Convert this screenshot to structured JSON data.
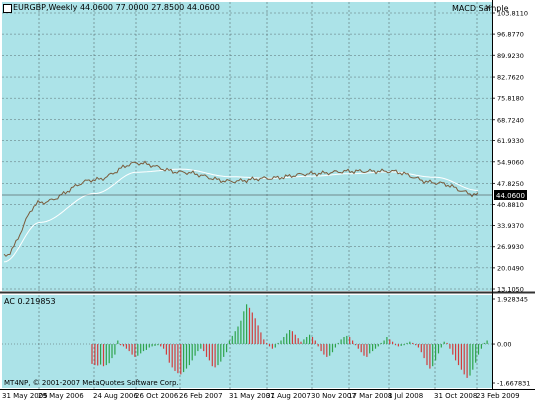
{
  "app": {
    "title": "MetaTrader chart window"
  },
  "colors": {
    "plot_bg": "#ace3e8",
    "grid": "#5a6e72",
    "price_line": "#7a5c3c",
    "signal_line": "#ffffff",
    "up_bar": "#2ea34a",
    "down_bar": "#d23c3c",
    "current_price_bg": "#000000",
    "axis_text": "#000000"
  },
  "header": {
    "symbol_info": "EURGBP,Weekly  44.0600 77.0000 27.8500 44.0600",
    "indicator": "MACD Sample",
    "close_glyph": "×"
  },
  "lower_panel": {
    "indicator_label": "AC 0.219853",
    "copyright": "MT4NP, © 2001-2007 MetaQuotes Software Corp."
  },
  "price_axis": {
    "ticks": [
      "103.8110",
      "96.8770",
      "89.9230",
      "82.7620",
      "75.8180",
      "68.7240",
      "61.9330",
      "54.9060",
      "47.8250",
      "40.8810",
      "33.9370",
      "26.9930",
      "20.0490",
      "13.1050"
    ],
    "current_price": "44.0600"
  },
  "indicator_axis": {
    "ticks": [
      "1.928345",
      "0.00",
      "-1.667831"
    ]
  },
  "time_axis": {
    "ticks": [
      "31 May 2005",
      "29 May 2006",
      "24 Aug 2006",
      "26 Oct 2006",
      "26 Feb 2007",
      "31 May 2007",
      "31 Aug 2007",
      "30 Nov 2007",
      "17 Mar 2008",
      "1 Jul 2008",
      "31 Oct 2008",
      "23 Feb 2009"
    ]
  },
  "chart_data": [
    {
      "type": "line",
      "title": "EURGBP,Weekly",
      "ylim": [
        13.105,
        103.811
      ],
      "x": [
        "31 May 2005",
        "29 May 2006",
        "24 Aug 2006",
        "26 Oct 2006",
        "26 Feb 2007",
        "31 May 2007",
        "31 Aug 2007",
        "30 Nov 2007",
        "17 Mar 2008",
        "1 Jul 2008",
        "31 Oct 2008",
        "23 Feb 2009"
      ],
      "series": [
        {
          "name": "",
          "values": [
            24.0,
            41.5,
            49.0,
            54.5,
            51.5,
            48.5,
            49.5,
            51.0,
            51.8,
            51.8,
            48.0,
            44.06
          ]
        },
        {
          "name": "",
          "values": [
            22.0,
            35.0,
            44.5,
            51.5,
            52.5,
            50.0,
            49.5,
            50.2,
            51.0,
            51.6,
            49.8,
            45.5
          ]
        }
      ]
    },
    {
      "type": "bar",
      "title": "AC 0.219853",
      "ylim": [
        -1.667831,
        1.928345
      ],
      "values": [
        -0.85,
        -0.9,
        -0.92,
        -0.88,
        -0.95,
        -0.9,
        -0.82,
        -0.6,
        -0.45,
        0.15,
        -0.05,
        -0.1,
        -0.2,
        -0.3,
        -0.45,
        -0.55,
        -0.5,
        -0.4,
        -0.3,
        -0.25,
        -0.15,
        -0.1,
        -0.08,
        -0.05,
        -0.1,
        -0.2,
        -0.45,
        -0.8,
        -1.0,
        -1.15,
        -1.25,
        -1.3,
        -1.2,
        -1.05,
        -0.9,
        -0.7,
        -0.5,
        -0.3,
        -0.2,
        -0.3,
        -0.55,
        -0.7,
        -0.95,
        -1.0,
        -0.9,
        -0.75,
        -0.55,
        -0.35,
        0.15,
        0.35,
        0.55,
        0.75,
        1.0,
        1.4,
        1.7,
        1.55,
        1.35,
        1.1,
        0.8,
        0.5,
        0.2,
        0.05,
        -0.1,
        -0.2,
        -0.15,
        0.05,
        0.15,
        0.3,
        0.45,
        0.6,
        0.55,
        0.4,
        0.25,
        0.1,
        0.2,
        0.3,
        0.4,
        0.3,
        0.15,
        -0.1,
        -0.3,
        -0.45,
        -0.55,
        -0.5,
        -0.35,
        -0.15,
        0.05,
        0.2,
        0.3,
        0.35,
        0.3,
        0.15,
        -0.05,
        -0.2,
        -0.35,
        -0.5,
        -0.55,
        -0.4,
        -0.3,
        -0.2,
        -0.1,
        0.05,
        0.15,
        0.3,
        0.2,
        0.1,
        -0.05,
        -0.1,
        -0.08,
        -0.05,
        0.05,
        0.1,
        0.05,
        -0.05,
        -0.15,
        -0.35,
        -0.6,
        -0.9,
        -1.05,
        -0.95,
        -0.7,
        -0.4,
        -0.15,
        0.1,
        0.05,
        -0.2,
        -0.45,
        -0.7,
        -0.9,
        -1.1,
        -1.3,
        -1.45,
        -1.35,
        -1.1,
        -0.8,
        -0.45,
        -0.2,
        0.05,
        0.15
      ]
    }
  ]
}
